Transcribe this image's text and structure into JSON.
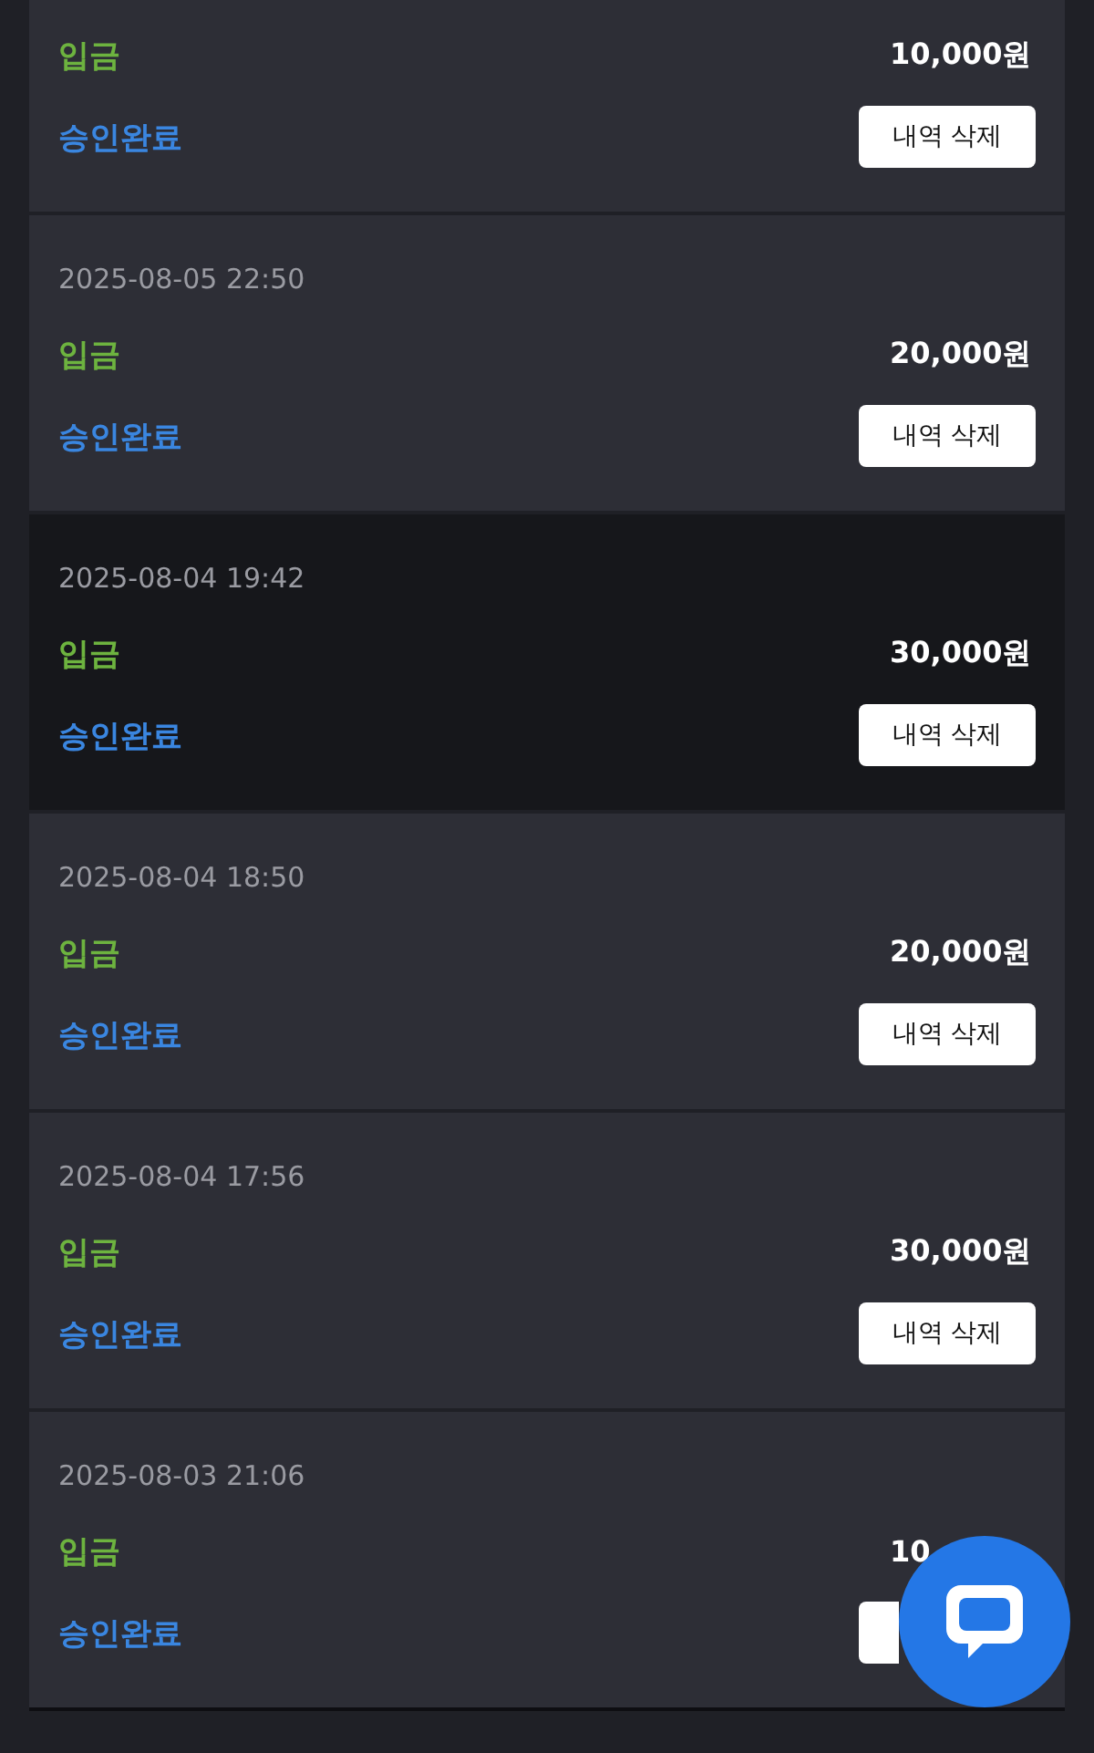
{
  "transactions": [
    {
      "type": "입금",
      "amount": "10,000원",
      "status": "승인완료",
      "button": "내역 삭제",
      "highlighted": false
    },
    {
      "date": "2025-08-05 22:50",
      "type": "입금",
      "amount": "20,000원",
      "status": "승인완료",
      "button": "내역 삭제",
      "highlighted": false
    },
    {
      "date": "2025-08-04 19:42",
      "type": "입금",
      "amount": "30,000원",
      "status": "승인완료",
      "button": "내역 삭제",
      "highlighted": true
    },
    {
      "date": "2025-08-04 18:50",
      "type": "입금",
      "amount": "20,000원",
      "status": "승인완료",
      "button": "내역 삭제",
      "highlighted": false
    },
    {
      "date": "2025-08-04 17:56",
      "type": "입금",
      "amount": "30,000원",
      "status": "승인완료",
      "button": "내역 삭제",
      "highlighted": false
    },
    {
      "date": "2025-08-03 21:06",
      "type": "입금",
      "amount": "10",
      "status": "승인완료",
      "highlighted": false
    }
  ],
  "chat_button": {
    "kind": "chat"
  }
}
